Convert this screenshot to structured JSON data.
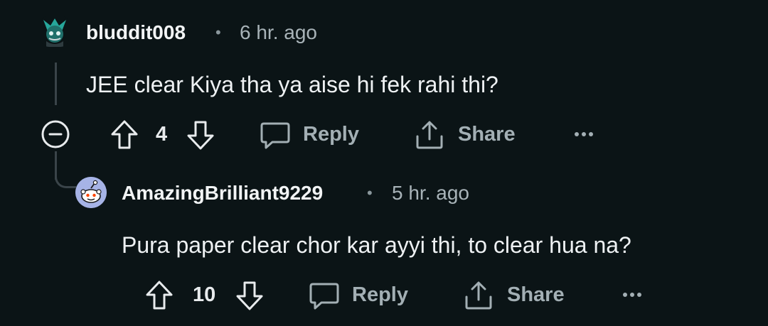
{
  "comments": [
    {
      "username": "bluddit008",
      "separator": "•",
      "time": "6 hr. ago",
      "body": "JEE clear Kiya tha ya aise hi fek rahi thi?",
      "votes": "4",
      "reply_label": "Reply",
      "share_label": "Share",
      "avatar_icon": "snoo-avatar-green",
      "collapse_icon": "minus-circle-icon"
    },
    {
      "username": "AmazingBrilliant9229",
      "separator": "•",
      "time": "5 hr. ago",
      "body": "Pura paper clear chor kar ayyi thi, to clear hua na?",
      "votes": "10",
      "reply_label": "Reply",
      "share_label": "Share",
      "avatar_icon": "default-snoo-avatar"
    }
  ],
  "colors": {
    "background": "#0b1416",
    "text": "#d7dadc",
    "muted": "#a3afb4",
    "thread_line": "#3a4449",
    "avatar_blue": "#a6b3e6"
  }
}
